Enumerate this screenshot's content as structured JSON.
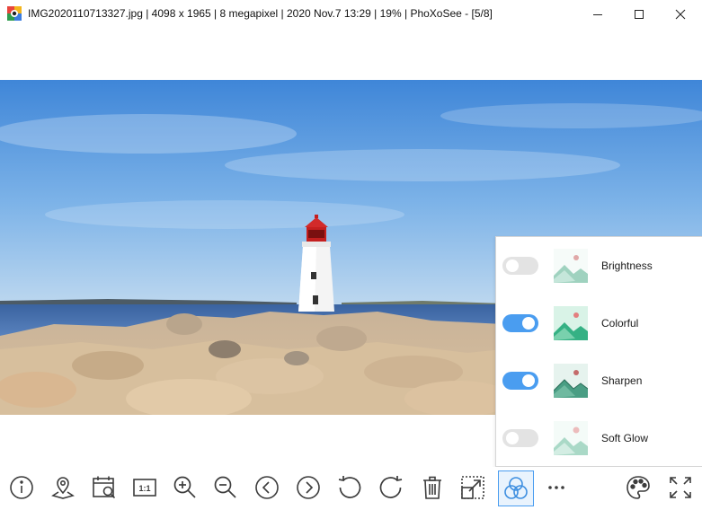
{
  "window": {
    "title": "IMG2020110713327.jpg  |  4098 x 1965  |  8 megapixel  |  2020 Nov.7 13:29  |  19%  |  PhoXoSee  -  [5/8]",
    "controls": [
      "minimize-icon",
      "maximize-icon",
      "close-icon"
    ]
  },
  "effects_panel": {
    "items": [
      {
        "label": "Brightness",
        "enabled": false
      },
      {
        "label": "Colorful",
        "enabled": true
      },
      {
        "label": "Sharpen",
        "enabled": true
      },
      {
        "label": "Soft Glow",
        "enabled": false
      }
    ]
  },
  "toolbar": {
    "buttons": [
      {
        "name": "info",
        "icon": "info-icon"
      },
      {
        "name": "location",
        "icon": "map-pin-icon"
      },
      {
        "name": "date-search",
        "icon": "calendar-search-icon"
      },
      {
        "name": "actual-size",
        "icon": "one-to-one-icon",
        "label": "1:1"
      },
      {
        "name": "zoom-in",
        "icon": "zoom-in-icon"
      },
      {
        "name": "zoom-out",
        "icon": "zoom-out-icon"
      },
      {
        "name": "previous",
        "icon": "arrow-left-circle-icon"
      },
      {
        "name": "next",
        "icon": "arrow-right-circle-icon"
      },
      {
        "name": "rotate-left",
        "icon": "rotate-left-icon"
      },
      {
        "name": "rotate-right",
        "icon": "rotate-right-icon"
      },
      {
        "name": "delete",
        "icon": "trash-icon"
      },
      {
        "name": "resize",
        "icon": "resize-icon"
      },
      {
        "name": "effects",
        "icon": "effects-icon",
        "active": true
      },
      {
        "name": "more",
        "icon": "more-icon"
      },
      {
        "name": "palette",
        "icon": "palette-icon"
      },
      {
        "name": "fullscreen",
        "icon": "fullscreen-icon"
      }
    ]
  },
  "colors": {
    "accent": "#4a9df0",
    "toggle_off": "#e3e3e3",
    "icon": "#3c3c3c"
  }
}
